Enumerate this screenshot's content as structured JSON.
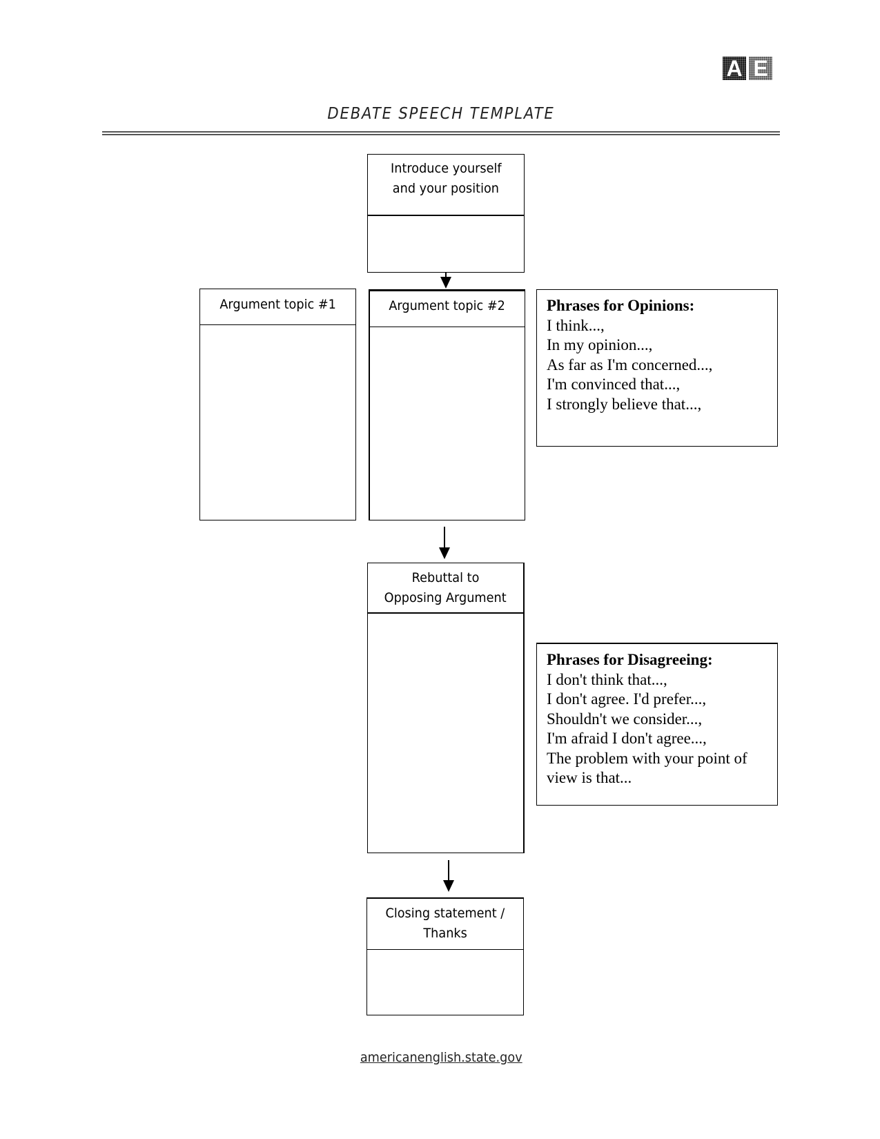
{
  "logo": {
    "letters": [
      "A",
      "E"
    ],
    "icon": "ae-logo-icon"
  },
  "document": {
    "title": "DEBATE SPEECH TEMPLATE"
  },
  "flow": {
    "intro": {
      "header": "Introduce yourself and your position",
      "lines": [
        "Introduce yourself",
        "and your position"
      ]
    },
    "argument_1": {
      "header": "Argument topic #1"
    },
    "argument_2": {
      "header": "Argument topic #2"
    },
    "rebuttal": {
      "header": "Rebuttal to Opposing Argument",
      "lines": [
        "Rebuttal to",
        "Opposing Argument"
      ]
    },
    "closing": {
      "header": "Closing statement / Thanks",
      "lines": [
        "Closing statement /",
        "Thanks"
      ]
    }
  },
  "phrases_opinions": {
    "title": "Phrases for Opinions:",
    "items": [
      "I think...,",
      "In my opinion...,",
      "As far as I'm concerned...,",
      "I'm convinced that...,",
      "I strongly believe that...,"
    ]
  },
  "phrases_disagreeing": {
    "title": "Phrases for Disagreeing:",
    "items": [
      "I don't think that...,",
      "I don't agree. I'd prefer...,",
      "Shouldn't we consider...,",
      "I'm afraid I don't agree...,",
      "The problem with your point of view is that..."
    ]
  },
  "footer": {
    "link_text": "americanenglish.state.gov"
  }
}
